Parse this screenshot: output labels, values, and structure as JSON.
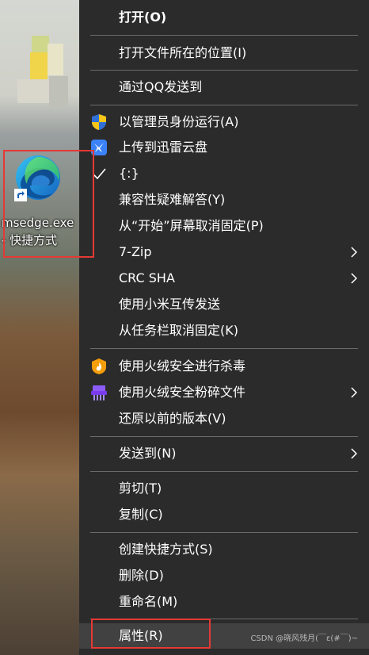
{
  "desktop": {
    "shortcut": {
      "name_line1": "msedge.exe",
      "name_line2": "- 快捷方式",
      "icon": "edge-icon"
    }
  },
  "context_menu": {
    "items": [
      {
        "label": "打开(O)",
        "bold": true
      },
      {
        "label": "打开文件所在的位置(I)"
      },
      {
        "label": "通过QQ发送到"
      },
      {
        "label": "以管理员身份运行(A)",
        "icon": "shield-icon"
      },
      {
        "label": "上传到迅雷云盘",
        "icon": "thunder-cloud-icon"
      },
      {
        "label": "{:}",
        "icon": "check-icon"
      },
      {
        "label": "兼容性疑难解答(Y)"
      },
      {
        "label": "从“开始”屏幕取消固定(P)"
      },
      {
        "label": "7-Zip",
        "submenu": true
      },
      {
        "label": "CRC SHA",
        "submenu": true
      },
      {
        "label": "使用小米互传发送"
      },
      {
        "label": "从任务栏取消固定(K)"
      },
      {
        "label": "使用火绒安全进行杀毒",
        "icon": "huorong-icon"
      },
      {
        "label": "使用火绒安全粉碎文件",
        "icon": "shredder-icon",
        "submenu": true
      },
      {
        "label": "还原以前的版本(V)"
      },
      {
        "label": "发送到(N)",
        "submenu": true
      },
      {
        "label": "剪切(T)"
      },
      {
        "label": "复制(C)"
      },
      {
        "label": "创建快捷方式(S)"
      },
      {
        "label": "删除(D)"
      },
      {
        "label": "重命名(M)"
      },
      {
        "label": "属性(R)",
        "highlighted": true
      }
    ]
  },
  "watermark": "CSDN @晓风残月(￣ε(#￣)~",
  "colors": {
    "menu_bg": "#2b2b2b",
    "hover_bg": "#414141",
    "highlight_frame": "#e53935"
  }
}
